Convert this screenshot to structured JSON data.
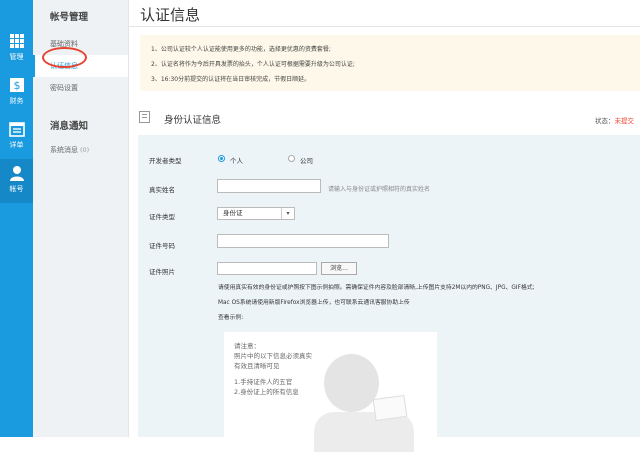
{
  "rail": [
    {
      "label": "管理",
      "icon": "grid-icon",
      "active": false
    },
    {
      "label": "财务",
      "icon": "finance-icon",
      "active": false
    },
    {
      "label": "详单",
      "icon": "calendar-icon",
      "active": false
    },
    {
      "label": "帐号",
      "icon": "user-icon",
      "active": true
    }
  ],
  "sidebar": {
    "section1": "帐号管理",
    "items1": [
      "基础资料",
      "认证信息",
      "密码设置"
    ],
    "section2": "消息通知",
    "items2_label": "系统消息",
    "items2_badge": "(0)"
  },
  "page": {
    "title": "认证信息",
    "notices": [
      "1、公司认证较个人认证能使用更多的功能，选择更优惠的资费套餐;",
      "2、认证名将作为今后开具发票的抬头，个人认证可根据需要升级为公司认证;",
      "3、16:30分前提交的认证将在当日审核完成，节假日顺延。"
    ]
  },
  "section": {
    "title": "身份认证信息",
    "status_label": "状态：",
    "status_value": "未提交"
  },
  "form": {
    "dev_type_label": "开发者类型",
    "dev_type_options": [
      "个人",
      "公司"
    ],
    "name_label": "真实姓名",
    "name_hint": "请输入与身份证或护照相符的真实姓名",
    "doc_type_label": "证件类型",
    "doc_type_value": "身份证",
    "doc_no_label": "证件号码",
    "photo_label": "证件照片",
    "browse_label": "浏览...",
    "note1": "请使用真实有效的身份证或护照按下图示例拍照。需确保证件内容及脸部清晰,上传图片支持2M以内的PNG、JPG、GIF格式;",
    "note2": "Mac OS系统请使用新版Firefox浏览器上传，也可联系云通讯客服协助上传",
    "example_label": "查看示例:",
    "example_text": [
      "请注意：",
      "照片中的以下信息必须真实",
      "有效且清晰可见",
      "1.手持证件人的五官",
      "2.身份证上的所有信息"
    ]
  }
}
